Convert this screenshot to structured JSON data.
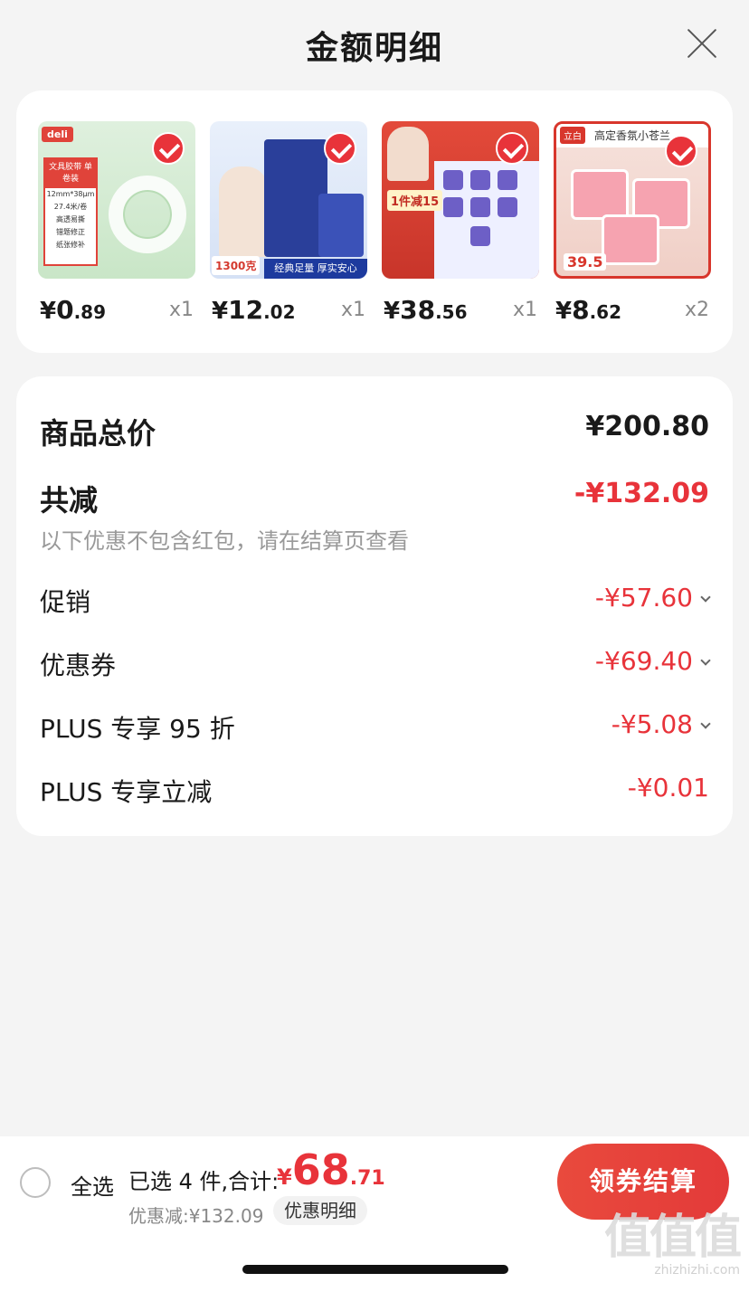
{
  "header": {
    "title": "金额明细"
  },
  "products": [
    {
      "currency": "¥",
      "price_int": "0",
      "price_dec": ".89",
      "qty": "x1",
      "thumb": {
        "brand": "deli",
        "label_top": "文具胶带 单卷装",
        "label_lines": [
          "12mm*38μm",
          "27.4米/卷",
          "高透易撕",
          "错题修正",
          "纸张修补"
        ]
      }
    },
    {
      "currency": "¥",
      "price_int": "12",
      "price_dec": ".02",
      "qty": "x1",
      "thumb": {
        "weight": "1300克",
        "band": "经典足量 厚实安心"
      }
    },
    {
      "currency": "¥",
      "price_int": "38",
      "price_dec": ".56",
      "qty": "x1",
      "thumb": {
        "tag": "1件减15"
      }
    },
    {
      "currency": "¥",
      "price_int": "8",
      "price_dec": ".62",
      "qty": "x2",
      "thumb": {
        "logo": "立白",
        "top_text": "高定香氛小苍兰",
        "price_tag": "39.5"
      }
    }
  ],
  "summary": {
    "total_label": "商品总价",
    "total_value": "¥200.80",
    "reduce_label": "共减",
    "reduce_value": "-¥132.09",
    "note": "以下优惠不包含红包，请在结算页查看",
    "items": [
      {
        "label": "促销",
        "value": "-¥57.60"
      },
      {
        "label": "优惠券",
        "value": "-¥69.40"
      },
      {
        "label": "PLUS 专享 95 折",
        "value": "-¥5.08"
      },
      {
        "label": "PLUS 专享立减",
        "value": "-¥0.01"
      }
    ]
  },
  "bottom": {
    "select_all": "全选",
    "selected_text": "已选 4 件,合计:",
    "currency": "¥",
    "total_int": "68",
    "total_dec": ".71",
    "discount_text": "优惠减:¥132.09",
    "detail_button": "优惠明细",
    "checkout_button": "领券结算"
  },
  "watermark": {
    "big": "值值值",
    "site": "zhizhizhi.com"
  },
  "colors": {
    "accent": "#e8333a",
    "background": "#f4f4f4",
    "card": "#ffffff"
  }
}
